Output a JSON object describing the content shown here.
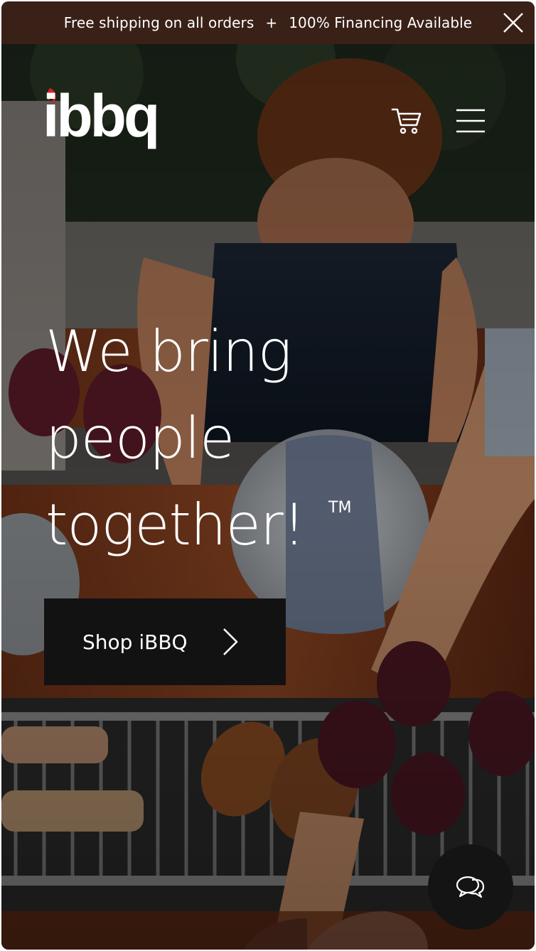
{
  "promo": {
    "shipping": "Free shipping on all orders",
    "separator": "+",
    "financing": "100% Financing Available",
    "close_icon": "close-icon"
  },
  "header": {
    "logo_text": "ibbq",
    "cart_icon": "cart-icon",
    "menu_icon": "hamburger-menu-icon"
  },
  "hero": {
    "headline_line1": "We bring",
    "headline_line2": "people",
    "headline_line3": "together!",
    "trademark": "TM",
    "cta_label": "Shop iBBQ",
    "cta_icon": "chevron-right-icon"
  },
  "chat": {
    "icon": "chat-bubbles-icon"
  },
  "colors": {
    "promo_bg": "#3a2118",
    "cta_bg": "#121212",
    "logo_accent": "#d6232a",
    "text": "#ffffff"
  }
}
